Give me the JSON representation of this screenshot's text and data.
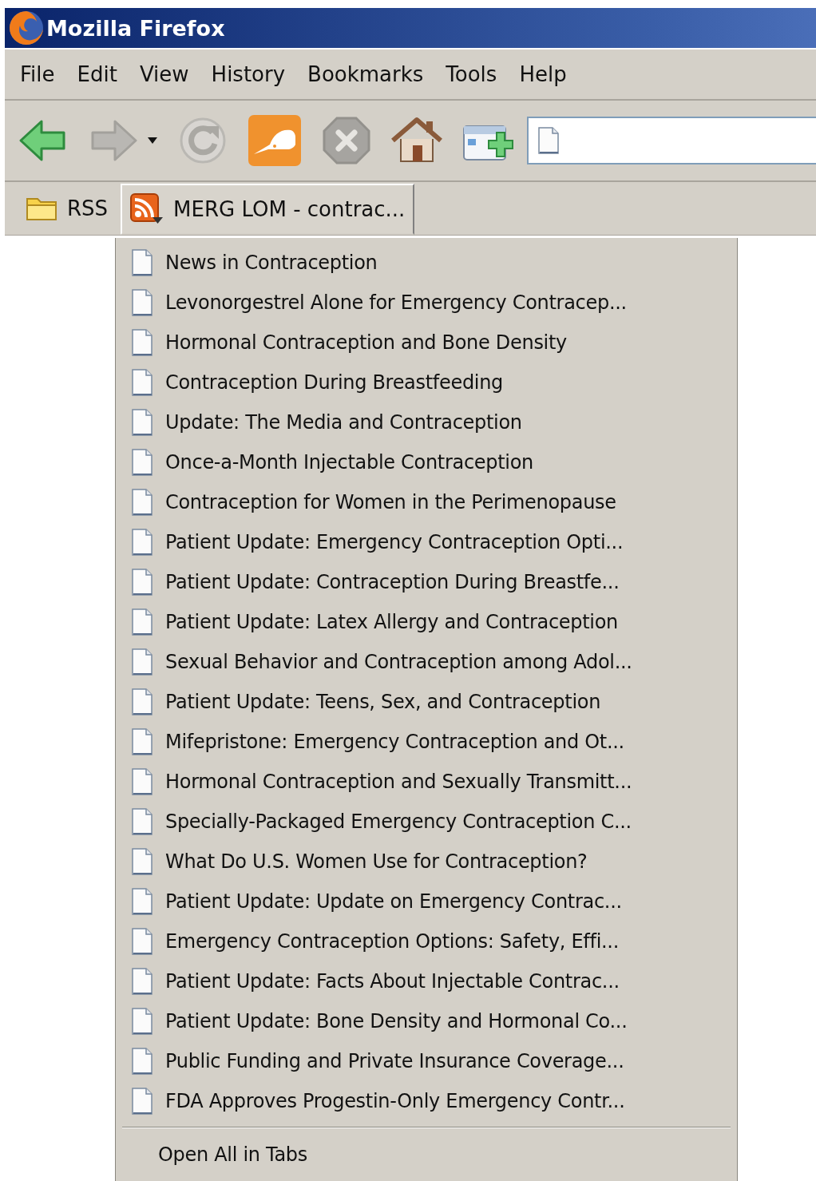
{
  "window": {
    "title": "Mozilla Firefox"
  },
  "menu_bar": [
    {
      "label": "File"
    },
    {
      "label": "Edit"
    },
    {
      "label": "View"
    },
    {
      "label": "History"
    },
    {
      "label": "Bookmarks"
    },
    {
      "label": "Tools"
    },
    {
      "label": "Help"
    }
  ],
  "toolbar": [
    {
      "kind": "back",
      "disabled": false
    },
    {
      "kind": "forward",
      "disabled": true
    },
    {
      "kind": "history-dropdown",
      "disabled": false
    },
    {
      "kind": "reload",
      "disabled": true
    },
    {
      "kind": "extension",
      "disabled": false
    },
    {
      "kind": "stop",
      "disabled": true
    },
    {
      "kind": "home",
      "disabled": false
    },
    {
      "kind": "new-tab",
      "disabled": false
    },
    {
      "kind": "address",
      "disabled": false
    }
  ],
  "bookmarks_toolbar": [
    {
      "kind": "folder",
      "label": "RSS",
      "open": false
    },
    {
      "kind": "feed",
      "label": "MERG LOM - contrac...",
      "open": true
    }
  ],
  "popup": {
    "items": [
      {
        "label": "News in Contraception"
      },
      {
        "label": "Levonorgestrel Alone for Emergency Contracep..."
      },
      {
        "label": "Hormonal Contraception and Bone Density"
      },
      {
        "label": "Contraception During Breastfeeding"
      },
      {
        "label": "Update: The Media and Contraception"
      },
      {
        "label": "Once-a-Month Injectable Contraception"
      },
      {
        "label": "Contraception for Women in the Perimenopause"
      },
      {
        "label": "Patient Update: Emergency Contraception Opti..."
      },
      {
        "label": "Patient Update: Contraception During Breastfe..."
      },
      {
        "label": "Patient Update: Latex Allergy and Contraception"
      },
      {
        "label": "Sexual Behavior and Contraception among Adol..."
      },
      {
        "label": "Patient Update: Teens, Sex, and Contraception"
      },
      {
        "label": "Mifepristone: Emergency Contraception and Ot..."
      },
      {
        "label": "Hormonal Contraception and Sexually Transmitt..."
      },
      {
        "label": "Specially-Packaged Emergency Contraception C..."
      },
      {
        "label": "What Do U.S. Women Use for Contraception?"
      },
      {
        "label": "Patient Update: Update on Emergency Contrac..."
      },
      {
        "label": "Emergency Contraception Options: Safety, Effi..."
      },
      {
        "label": "Patient Update: Facts About Injectable Contrac..."
      },
      {
        "label": "Patient Update: Bone Density and Hormonal Co..."
      },
      {
        "label": "Public Funding and Private Insurance Coverage..."
      },
      {
        "label": "FDA Approves Progestin-Only Emergency Contr..."
      }
    ],
    "footer": {
      "label": "Open All in Tabs"
    }
  }
}
